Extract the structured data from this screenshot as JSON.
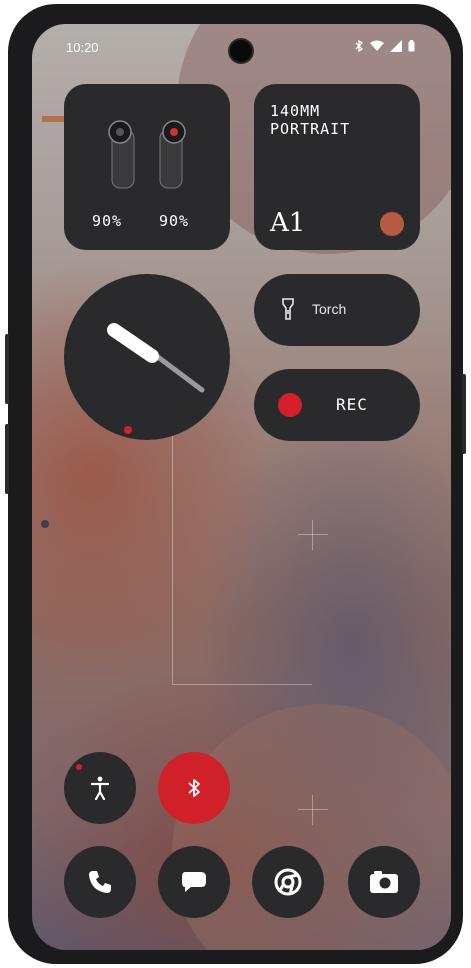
{
  "status_bar": {
    "time": "10:20"
  },
  "earbuds": {
    "left_battery": "90%",
    "right_battery": "90%"
  },
  "camera_widget": {
    "title_line1": "140MM",
    "title_line2": "PORTRAIT",
    "label": "A1",
    "accent_color": "#b85a40"
  },
  "torch": {
    "label": "Torch"
  },
  "recorder": {
    "label": "REC",
    "accent_color": "#d3202a"
  },
  "quick_buttons": [
    {
      "icon": "accessibility-icon"
    },
    {
      "icon": "bluetooth-icon",
      "active_color": "#d0202a"
    }
  ],
  "dock": [
    {
      "icon": "phone-icon"
    },
    {
      "icon": "messages-icon"
    },
    {
      "icon": "chrome-icon"
    },
    {
      "icon": "camera-icon"
    }
  ]
}
